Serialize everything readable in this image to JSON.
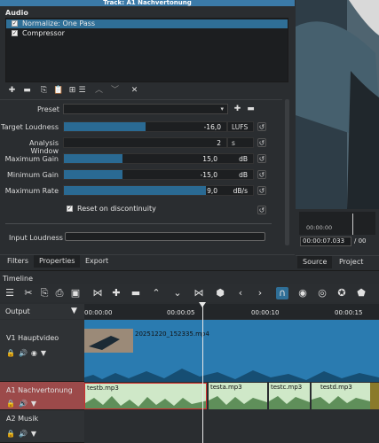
{
  "filter_panel": {
    "track_title": "Track: A1 Nachvertonung",
    "audio_heading": "Audio",
    "filters": [
      {
        "label": "Normalize: One Pass",
        "checked": true,
        "selected": true
      },
      {
        "label": "Compressor",
        "checked": true,
        "selected": false
      }
    ],
    "preset_label": "Preset",
    "params": [
      {
        "label": "Target Loudness",
        "value": "-16,0",
        "unit": "LUFS",
        "fill": 0.5
      },
      {
        "label": "Analysis Window",
        "value": "2",
        "unit": "s",
        "fill": 0.0
      },
      {
        "label": "Maximum Gain",
        "value": "15,0",
        "unit": "dB",
        "fill": 0.31
      },
      {
        "label": "Minimum Gain",
        "value": "-15,0",
        "unit": "dB",
        "fill": 0.31
      },
      {
        "label": "Maximum Rate",
        "value": "9,0",
        "unit": "dB/s",
        "fill": 0.75
      }
    ],
    "reset_checkbox": "Reset on discontinuity",
    "input_loudness_label": "Input Loudness"
  },
  "left_tabs": [
    "Filters",
    "Properties",
    "Export"
  ],
  "preview": {
    "timecode_top": "00:00:00",
    "timecode": "00:00:07.033",
    "timecode_sep": "/ 00",
    "tabs": [
      "Source",
      "Project"
    ]
  },
  "timeline": {
    "label": "Timeline",
    "output_label": "Output",
    "ruler": [
      "00:00:00",
      "00:00:05",
      "00:00:10",
      "00:00:15"
    ],
    "tracks": [
      {
        "name": "V1 Hauptvideo"
      },
      {
        "name": "A1 Nachvertonung"
      },
      {
        "name": "A2 Musik"
      }
    ],
    "clips": {
      "video": "20251220_152335.mp4",
      "audio": [
        "testb.mp3",
        "testa.mp3",
        "testc.mp3",
        "testd.mp3"
      ]
    }
  },
  "colors": {
    "accent": "#2f6f97",
    "video_track": "#2a7bb0",
    "audio_clip": "#cfe8c8",
    "selected_head": "#9c4a4a"
  }
}
